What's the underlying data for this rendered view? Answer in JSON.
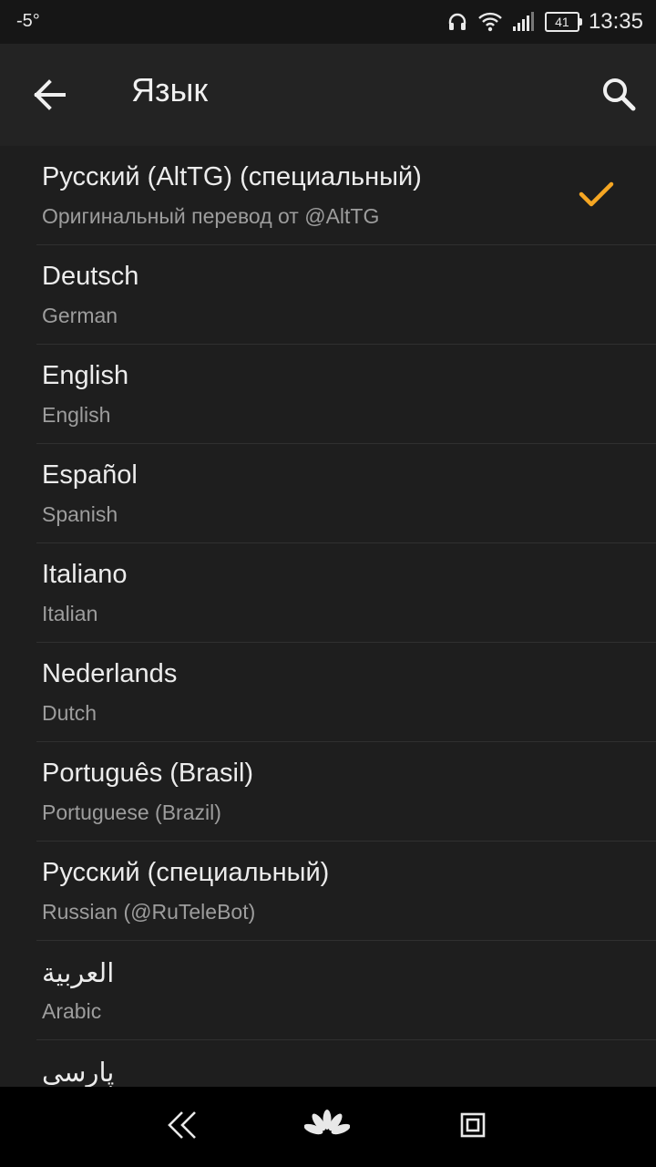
{
  "status": {
    "temperature": "-5°",
    "battery": "41",
    "time": "13:35"
  },
  "appbar": {
    "title": "Язык"
  },
  "languages": [
    {
      "name": "Русский (AltTG) (специальный)",
      "subtitle": "Оригинальный перевод от @AltTG",
      "selected": true
    },
    {
      "name": "Deutsch",
      "subtitle": "German"
    },
    {
      "name": "English",
      "subtitle": "English"
    },
    {
      "name": "Español",
      "subtitle": "Spanish"
    },
    {
      "name": "Italiano",
      "subtitle": "Italian"
    },
    {
      "name": "Nederlands",
      "subtitle": "Dutch"
    },
    {
      "name": "Português (Brasil)",
      "subtitle": "Portuguese (Brazil)"
    },
    {
      "name": "Русский (специальный)",
      "subtitle": "Russian (@RuTeleBot)"
    },
    {
      "name": "العربية",
      "subtitle": "Arabic"
    },
    {
      "name": "پارسی",
      "subtitle": ""
    }
  ],
  "colors": {
    "accent": "#f5a623",
    "background": "#1e1e1e",
    "appbar": "#232323"
  },
  "icons": [
    "back-arrow-icon",
    "search-icon",
    "checkmark-icon",
    "headphones-icon",
    "wifi-icon",
    "signal-icon",
    "battery-icon",
    "nav-back-icon",
    "nav-home-icon",
    "nav-recents-icon"
  ]
}
